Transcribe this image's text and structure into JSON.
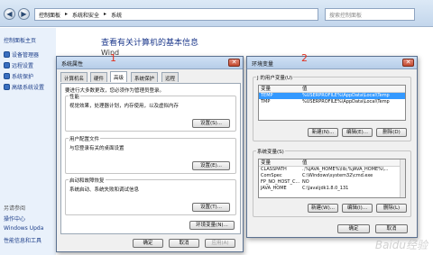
{
  "address": {
    "back_glyph": "◀",
    "forward_glyph": "▶",
    "crumbs": [
      "控制面板",
      "系统和安全",
      "系统"
    ],
    "separator": "▸",
    "search_placeholder": "搜索控制面板"
  },
  "sidebar": {
    "home": "控制面板主页",
    "items": [
      "设备管理器",
      "远程设置",
      "系统保护",
      "高级系统设置"
    ],
    "see_also_title": "另请参阅",
    "see_also": [
      "操作中心",
      "Windows Upda",
      "性能信息和工具"
    ]
  },
  "main": {
    "title": "查看有关计算机的基本信息",
    "partial": "Wind"
  },
  "sysprops": {
    "title": "系统属性",
    "close_glyph": "✕",
    "tabs": [
      "计算机名",
      "硬件",
      "高级",
      "系统保护",
      "远程"
    ],
    "admin_note": "要进行大多数更改，您必须作为管理员登录。",
    "groups": [
      {
        "title": "性能",
        "desc": "视觉效果，处理器计划，内存使用，以及虚拟内存",
        "button": "设置(S)..."
      },
      {
        "title": "用户配置文件",
        "desc": "与您登录有关的桌面设置",
        "button": "设置(E)..."
      },
      {
        "title": "启动和故障恢复",
        "desc": "系统启动、系统失败和调试信息",
        "button": "设置(T)..."
      }
    ],
    "env_button": "环境变量(N)...",
    "ok": "确定",
    "cancel": "取消",
    "apply": "应用(A)"
  },
  "envvars": {
    "title": "环境变量",
    "close_glyph": "✕",
    "user_section": "J 的用户变量(U)",
    "col_var": "变量",
    "col_val": "值",
    "user_rows": [
      {
        "name": "TEMP",
        "value": "%USERPROFILE%\\AppData\\Local\\Temp",
        "selected": true
      },
      {
        "name": "TMP",
        "value": "%USERPROFILE%\\AppData\\Local\\Temp",
        "selected": false
      }
    ],
    "user_buttons": [
      "新建(N)...",
      "编辑(E)...",
      "删除(D)"
    ],
    "sys_section": "系统变量(S)",
    "sys_rows": [
      {
        "name": "CLASSPATH",
        "value": ".;%JAVA_HOME%\\lib;%JAVA_HOME%\\..."
      },
      {
        "name": "ComSpec",
        "value": "C:\\Windows\\system32\\cmd.exe"
      },
      {
        "name": "FP_NO_HOST_C...",
        "value": "NO"
      },
      {
        "name": "JAVA_HOME",
        "value": "C:\\Java\\jdk1.8.0_131"
      }
    ],
    "sys_buttons": [
      "新建(W)...",
      "编辑(I)...",
      "删除(L)"
    ],
    "ok": "确定",
    "cancel": "取消"
  },
  "annotations": [
    "1",
    "2"
  ],
  "watermark": "Baidu经验"
}
